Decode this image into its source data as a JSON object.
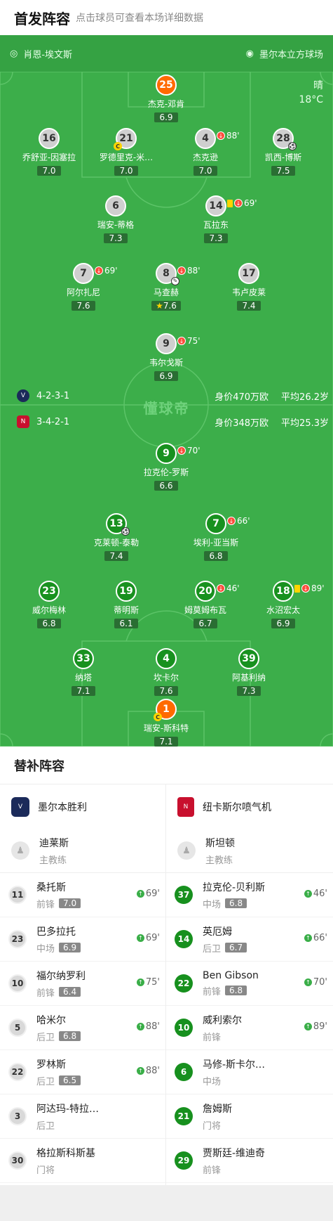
{
  "header": {
    "title": "首发阵容",
    "subtitle": "点击球员可查看本场详细数据"
  },
  "pitch": {
    "referee": "肖恩-埃文斯",
    "stadium": "墨尔本立方球场",
    "weather": "晴",
    "temperature": "18°C",
    "watermark": "懂球帝",
    "home": {
      "formation": "4-2-3-1",
      "value": "身价470万欧",
      "age": "平均26.2岁"
    },
    "away": {
      "formation": "3-4-2-1",
      "value": "身价348万欧",
      "age": "平均25.3岁"
    }
  },
  "home_players": [
    {
      "num": "25",
      "name": "杰克-邓肯",
      "rating": "6.9",
      "gk": true
    },
    {
      "num": "16",
      "name": "乔舒亚-因塞拉",
      "rating": "7.0"
    },
    {
      "num": "21",
      "name": "罗德里克-米…",
      "rating": "7.0",
      "captain": "C"
    },
    {
      "num": "4",
      "name": "杰克逊",
      "rating": "7.0",
      "sub": "88'"
    },
    {
      "num": "28",
      "name": "凯西-博斯",
      "rating": "7.5",
      "goal": true
    },
    {
      "num": "6",
      "name": "瑞安-蒂格",
      "rating": "7.3"
    },
    {
      "num": "14",
      "name": "瓦拉东",
      "rating": "7.3",
      "sub": "69'",
      "yellow": true
    },
    {
      "num": "7",
      "name": "阿尔扎尼",
      "rating": "7.6",
      "sub": "69'"
    },
    {
      "num": "8",
      "name": "马查赫",
      "rating": "7.6",
      "sub": "88'",
      "assist": true,
      "mvp": true
    },
    {
      "num": "17",
      "name": "韦卢皮莱",
      "rating": "7.4"
    },
    {
      "num": "9",
      "name": "韦尔戈斯",
      "rating": "6.9",
      "sub": "75'"
    }
  ],
  "away_players": [
    {
      "num": "9",
      "name": "拉克伦-罗斯",
      "rating": "6.6",
      "sub": "70'"
    },
    {
      "num": "13",
      "name": "克莱顿-泰勒",
      "rating": "7.4",
      "goal": true
    },
    {
      "num": "7",
      "name": "埃利-亚当斯",
      "rating": "6.8",
      "sub": "66'"
    },
    {
      "num": "23",
      "name": "威尔梅林",
      "rating": "6.8"
    },
    {
      "num": "19",
      "name": "蒂明斯",
      "rating": "6.1"
    },
    {
      "num": "20",
      "name": "姆莫姆布瓦",
      "rating": "6.7",
      "sub": "46'"
    },
    {
      "num": "18",
      "name": "水沼宏太",
      "rating": "6.9",
      "sub": "89'",
      "yellow": true
    },
    {
      "num": "33",
      "name": "纳塔",
      "rating": "7.1"
    },
    {
      "num": "4",
      "name": "坎卡尔",
      "rating": "7.6"
    },
    {
      "num": "39",
      "name": "阿基利纳",
      "rating": "7.3"
    },
    {
      "num": "1",
      "name": "瑞安-斯科特",
      "rating": "7.1",
      "gk": true,
      "captain": "C"
    }
  ],
  "subs": {
    "title": "替补阵容",
    "home": {
      "team": "墨尔本胜利",
      "coach": "迪莱斯",
      "coach_role": "主教练",
      "players": [
        {
          "num": "11",
          "name": "桑托斯",
          "pos": "前锋",
          "rating": "7.0",
          "time": "69'"
        },
        {
          "num": "23",
          "name": "巴多拉托",
          "pos": "中场",
          "rating": "6.9",
          "time": "69'"
        },
        {
          "num": "10",
          "name": "福尔纳罗利",
          "pos": "前锋",
          "rating": "6.4",
          "time": "75'"
        },
        {
          "num": "5",
          "name": "哈米尔",
          "pos": "后卫",
          "rating": "6.8",
          "time": "88'"
        },
        {
          "num": "22",
          "name": "罗林斯",
          "pos": "后卫",
          "rating": "6.5",
          "time": "88'"
        },
        {
          "num": "3",
          "name": "阿达玛-特拉…",
          "pos": "后卫"
        },
        {
          "num": "30",
          "name": "格拉斯科斯基",
          "pos": "门将"
        }
      ]
    },
    "away": {
      "team": "纽卡斯尔喷气机",
      "coach": "斯坦顿",
      "coach_role": "主教练",
      "players": [
        {
          "num": "37",
          "name": "拉克伦-贝利斯",
          "pos": "中场",
          "rating": "6.8",
          "time": "46'"
        },
        {
          "num": "14",
          "name": "英厄姆",
          "pos": "后卫",
          "rating": "6.7",
          "time": "66'"
        },
        {
          "num": "22",
          "name": "Ben Gibson",
          "pos": "前锋",
          "rating": "6.8",
          "time": "70'"
        },
        {
          "num": "10",
          "name": "威利索尔",
          "pos": "前锋",
          "time": "89'"
        },
        {
          "num": "6",
          "name": "马修-斯卡尔…",
          "pos": "中场"
        },
        {
          "num": "21",
          "name": "詹姆斯",
          "pos": "门将"
        },
        {
          "num": "29",
          "name": "贾斯廷-维迪奇",
          "pos": "前锋"
        }
      ]
    }
  }
}
